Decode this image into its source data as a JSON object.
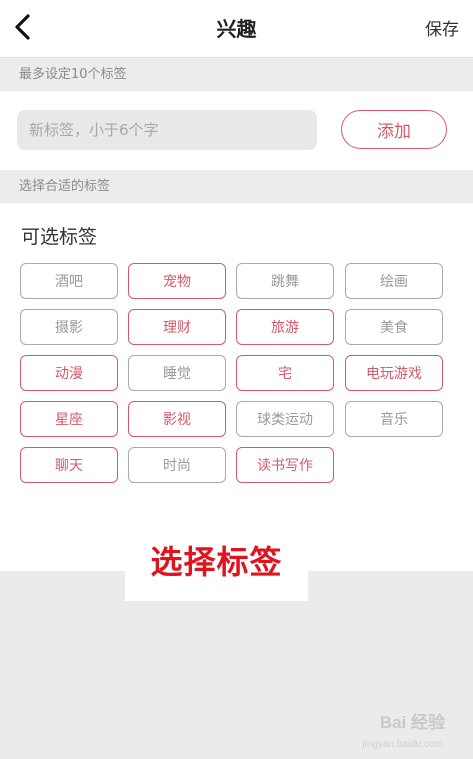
{
  "header": {
    "title": "兴趣",
    "save_label": "保存",
    "back_icon": "chevron-left-icon"
  },
  "limit_bar": {
    "text": "最多设定10个标签"
  },
  "input": {
    "placeholder": "新标签，小于6个字",
    "value": "",
    "add_label": "添加"
  },
  "suggest_bar": {
    "text": "选择合适的标签"
  },
  "tags_section": {
    "heading": "可选标签",
    "tags": [
      {
        "label": "酒吧",
        "selected": false
      },
      {
        "label": "宠物",
        "selected": true
      },
      {
        "label": "跳舞",
        "selected": false
      },
      {
        "label": "绘画",
        "selected": false
      },
      {
        "label": "摄影",
        "selected": false
      },
      {
        "label": "理财",
        "selected": true
      },
      {
        "label": "旅游",
        "selected": true
      },
      {
        "label": "美食",
        "selected": false
      },
      {
        "label": "动漫",
        "selected": true
      },
      {
        "label": "睡觉",
        "selected": false
      },
      {
        "label": "宅",
        "selected": true
      },
      {
        "label": "电玩游戏",
        "selected": true
      },
      {
        "label": "星座",
        "selected": true
      },
      {
        "label": "影视",
        "selected": true
      },
      {
        "label": "球类运动",
        "selected": false
      },
      {
        "label": "音乐",
        "selected": false
      },
      {
        "label": "聊天",
        "selected": true
      },
      {
        "label": "时尚",
        "selected": false
      },
      {
        "label": "读书写作",
        "selected": true
      }
    ]
  },
  "overlay": {
    "caption": "选择标签"
  },
  "watermark": {
    "text": "Bai 经验",
    "sub": "jingyan.baidu.com"
  },
  "colors": {
    "accent": "#d45a6b",
    "tag_border": "#a9a9a9",
    "caption": "#e0141e",
    "section_bg": "#ececec"
  }
}
